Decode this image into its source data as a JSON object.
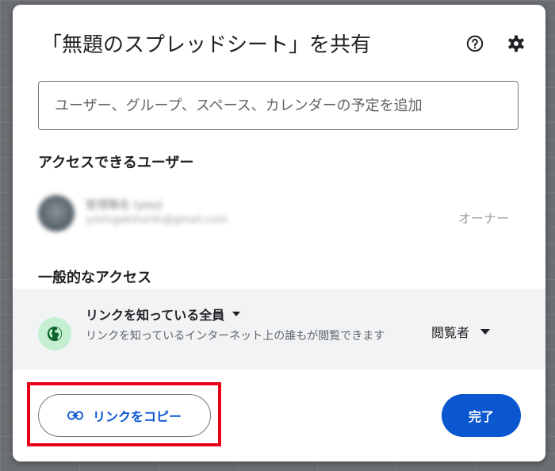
{
  "dialog": {
    "title": "「無題のスプレッドシート」を共有",
    "help_icon": "help-circle-icon",
    "settings_icon": "gear-icon"
  },
  "search": {
    "placeholder": "ユーザー、グループ、スペース、カレンダーの予定を追加"
  },
  "people_section": {
    "heading": "アクセスできるユーザー",
    "users": [
      {
        "name": "管理職名 (you)",
        "email": "yoshigakihoriki@gmail.com",
        "role": "オーナー"
      }
    ]
  },
  "general_access": {
    "heading": "一般的なアクセス",
    "icon": "globe-icon",
    "type_label": "リンクを知っている全員",
    "description": "リンクを知っているインターネット上の誰もが閲覧できます",
    "role_label": "閲覧者"
  },
  "footer": {
    "copy_link_label": "リンクをコピー",
    "copy_link_icon": "link-icon",
    "done_label": "完了"
  },
  "colors": {
    "primary": "#0b57d0",
    "highlight": "#e6001a",
    "globe_bg": "#c4eed0",
    "globe_fg": "#0d652d",
    "panel_bg": "#f1f3f4"
  }
}
